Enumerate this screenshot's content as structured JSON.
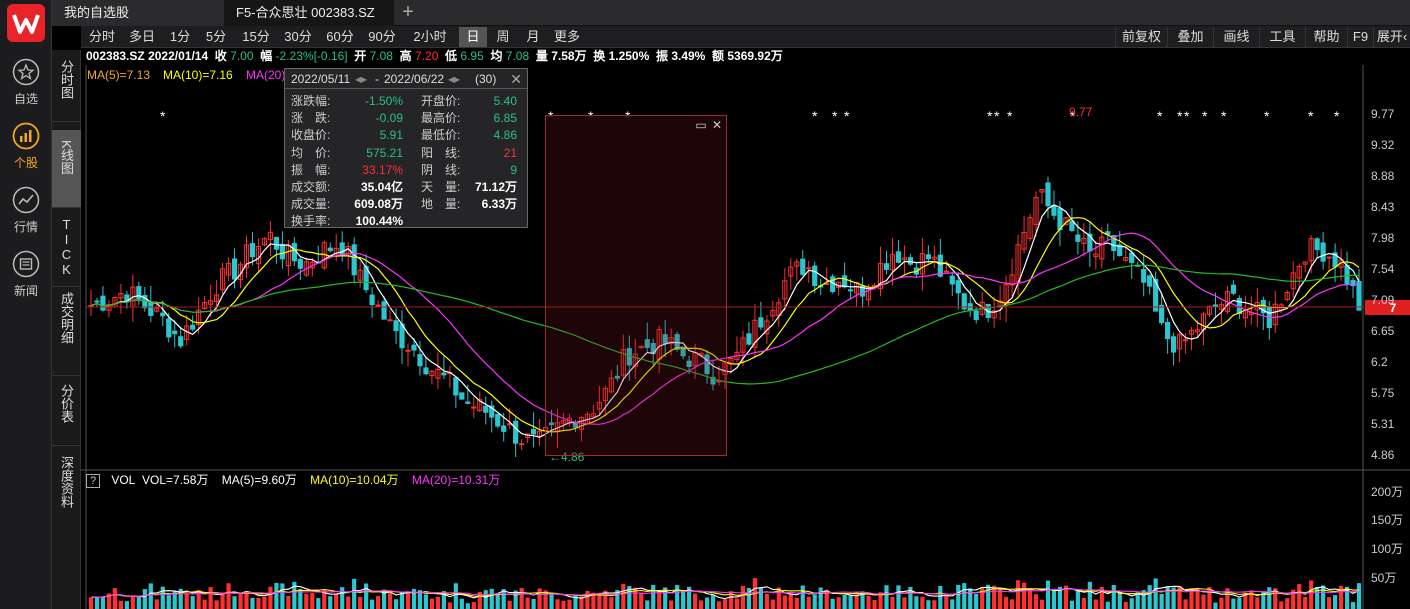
{
  "app": {
    "logo": "wind-logo"
  },
  "sidebar": {
    "items": [
      {
        "label": "自选",
        "icon": "star-icon"
      },
      {
        "label": "个股",
        "icon": "chart-icon",
        "active": true
      },
      {
        "label": "行情",
        "icon": "trend-icon"
      },
      {
        "label": "新闻",
        "icon": "news-icon"
      }
    ]
  },
  "window_tabs": [
    {
      "label": "我的自选股"
    },
    {
      "label": "F5-合众思壮 002383.SZ"
    }
  ],
  "view_tabs": [
    {
      "label": "分时图"
    },
    {
      "label": "K线图",
      "active": true
    },
    {
      "label": "TICK"
    },
    {
      "label": "成交明细"
    },
    {
      "label": "分价表"
    },
    {
      "label": "深度资料"
    }
  ],
  "periods": [
    "分时",
    "多日",
    "1分",
    "5分",
    "15分",
    "30分",
    "60分",
    "90分",
    "2小时",
    "日",
    "周",
    "月",
    "更多"
  ],
  "active_period": "日",
  "toolbar_right": [
    "前复权",
    "叠加",
    "画线",
    "工具",
    "帮助",
    "F9",
    "展开"
  ],
  "quote": {
    "code": "002383.SZ",
    "date": "2022/01/14",
    "close_label": "收",
    "close": "7.00",
    "change_label": "幅",
    "change": "-2.23%[-0.16]",
    "open_label": "开",
    "open": "7.08",
    "high_label": "高",
    "high": "7.20",
    "low_label": "低",
    "low": "6.95",
    "avg_label": "均",
    "avg": "7.08",
    "volume_label": "量",
    "volume": "7.58万",
    "turnover_label": "换",
    "turnover": "1.250%",
    "amp_label": "振",
    "amp": "3.49%",
    "amount_label": "额",
    "amount": "5369.92万"
  },
  "ma_legend": {
    "ma5": "MA(5)=7.13",
    "ma10": "MA(10)=7.16",
    "ma20": "MA(20)"
  },
  "price_axis": [
    "9.77",
    "9.32",
    "8.88",
    "8.43",
    "7.98",
    "7.54",
    "7.09",
    "6.65",
    "6.2",
    "5.75",
    "5.31",
    "4.86"
  ],
  "current_price_tag": "7",
  "high_mark": "9.77",
  "low_mark": "←4.86",
  "stats_tooltip": {
    "start": "2022/05/11",
    "end": "2022/06/22",
    "count": "(30)",
    "rows": [
      {
        "l1": "涨跌幅:",
        "v1": "-1.50%",
        "c1": "g",
        "l2": "开盘价:",
        "v2": "5.40",
        "c2": "g"
      },
      {
        "l1": "涨　跌:",
        "v1": "-0.09",
        "c1": "g",
        "l2": "最高价:",
        "v2": "6.85",
        "c2": "g"
      },
      {
        "l1": "收盘价:",
        "v1": "5.91",
        "c1": "g",
        "l2": "最低价:",
        "v2": "4.86",
        "c2": "g"
      },
      {
        "l1": "均　价:",
        "v1": "575.21",
        "c1": "g",
        "l2": "阳　线:",
        "v2": "21",
        "c2": "r"
      },
      {
        "l1": "振　幅:",
        "v1": "33.17%",
        "c1": "r",
        "l2": "阴　线:",
        "v2": "9",
        "c2": "g"
      },
      {
        "l1": "成交额:",
        "v1": "35.04亿",
        "c1": "w",
        "l2": "天　量:",
        "v2": "71.12万",
        "c2": "w"
      },
      {
        "l1": "成交量:",
        "v1": "609.08万",
        "c1": "w",
        "l2": "地　量:",
        "v2": "6.33万",
        "c2": "w"
      },
      {
        "l1": "换手率:",
        "v1": "100.44%",
        "c1": "w",
        "l2": "",
        "v2": "",
        "c2": "w"
      }
    ]
  },
  "volume_legend": {
    "help": "?",
    "title": "VOL",
    "vol": "VOL=7.58万",
    "ma5": "MA(5)=9.60万",
    "ma10": "MA(10)=10.04万",
    "ma20": "MA(20)=10.31万"
  },
  "volume_axis": [
    "200万",
    "150万",
    "100万",
    "50万"
  ],
  "colors": {
    "up": "#ff3030",
    "down": "#29c7d0",
    "ma5": "#ffffff",
    "ma10": "#ffff00",
    "ma20": "#ff33ff",
    "ma60": "#22bb22",
    "accent": "#f5a623"
  },
  "chart_data": {
    "type": "candlestick",
    "y_range": [
      4.86,
      9.77
    ],
    "volume_range_wan": [
      0,
      200
    ],
    "ohlc_close_series_sample": [
      7.0,
      7.1,
      7.2,
      7.0,
      6.8,
      6.5,
      6.9,
      7.3,
      7.5,
      7.8,
      8.0,
      7.7,
      7.6,
      7.8,
      7.9,
      7.4,
      7.0,
      6.6,
      6.4,
      6.1,
      5.9,
      5.6,
      5.5,
      5.3,
      5.1,
      5.0,
      5.2,
      5.4,
      5.5,
      5.8,
      6.3,
      6.4,
      6.5,
      6.3,
      6.2,
      6.0,
      6.2,
      6.6,
      7.0,
      7.4,
      7.6,
      7.3,
      7.4,
      7.2,
      7.5,
      7.8,
      7.6,
      7.7,
      7.3,
      7.0,
      6.9,
      7.2,
      7.9,
      8.6,
      8.3,
      8.0,
      7.7,
      7.9,
      7.6,
      7.3,
      6.6,
      6.4,
      6.7,
      7.0,
      7.1,
      6.9,
      6.8,
      7.3,
      7.8,
      7.8,
      7.6,
      7.0
    ]
  }
}
